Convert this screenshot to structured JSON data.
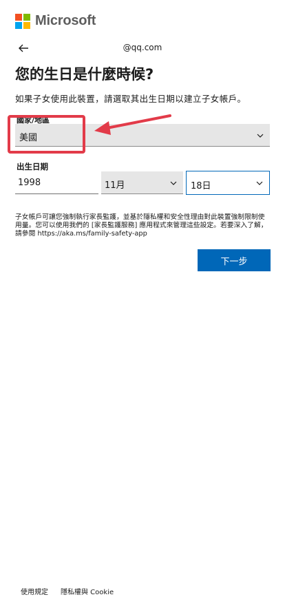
{
  "header": {
    "brand": "Microsoft",
    "logo_colors": [
      "#f25022",
      "#7fba00",
      "#00a4ef",
      "#ffb900"
    ],
    "identity": "@qq.com",
    "back_icon": "arrow-left-icon"
  },
  "title": "您的生日是什麼時候?",
  "description": "如果子女使用此裝置，請選取其出生日期以建立子女帳戶。",
  "region": {
    "label": "國家/地區",
    "value": "美國",
    "icon": "chevron-down-icon"
  },
  "dob": {
    "label": "出生日期",
    "year": "1998",
    "month": "11月",
    "day": "18日"
  },
  "notice": "子女帳戶可讓您強制執行家長監護，並基於隱私權和安全性理由對此裝置強制限制使用量。您可以使用我們的 [家長監護服務] 應用程式來管理這些設定。若要深入了解，請參閱 https://aka.ms/family-safety-app",
  "next_button": "下一步",
  "footer": {
    "terms": "使用規定",
    "privacy": "隱私權與 Cookie"
  },
  "colors": {
    "accent": "#0067b8",
    "annotation": "#e23b49"
  }
}
